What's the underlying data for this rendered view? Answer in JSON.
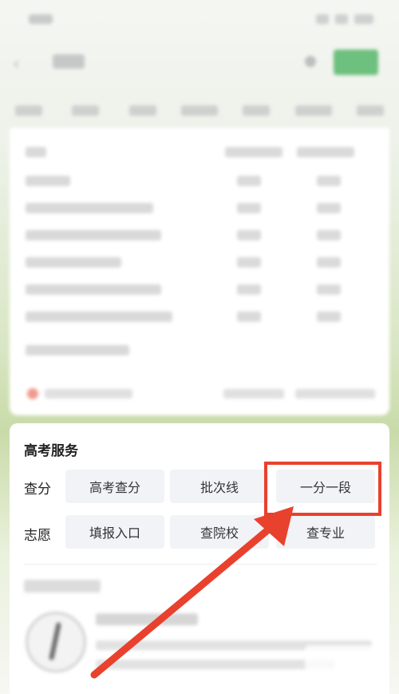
{
  "service_panel": {
    "title": "高考服务",
    "rows": [
      {
        "label": "查分",
        "buttons": [
          "高考查分",
          "批次线",
          "一分一段"
        ]
      },
      {
        "label": "志愿",
        "buttons": [
          "填报入口",
          "查院校",
          "查专业"
        ]
      }
    ]
  },
  "icons": {
    "back": "chevron-left-icon",
    "clear": "clear-icon",
    "emblem": "quill-emblem-icon"
  },
  "colors": {
    "accent_green": "#6dc07d",
    "highlight_red": "#e8412d",
    "button_bg": "#f1f3f6"
  }
}
